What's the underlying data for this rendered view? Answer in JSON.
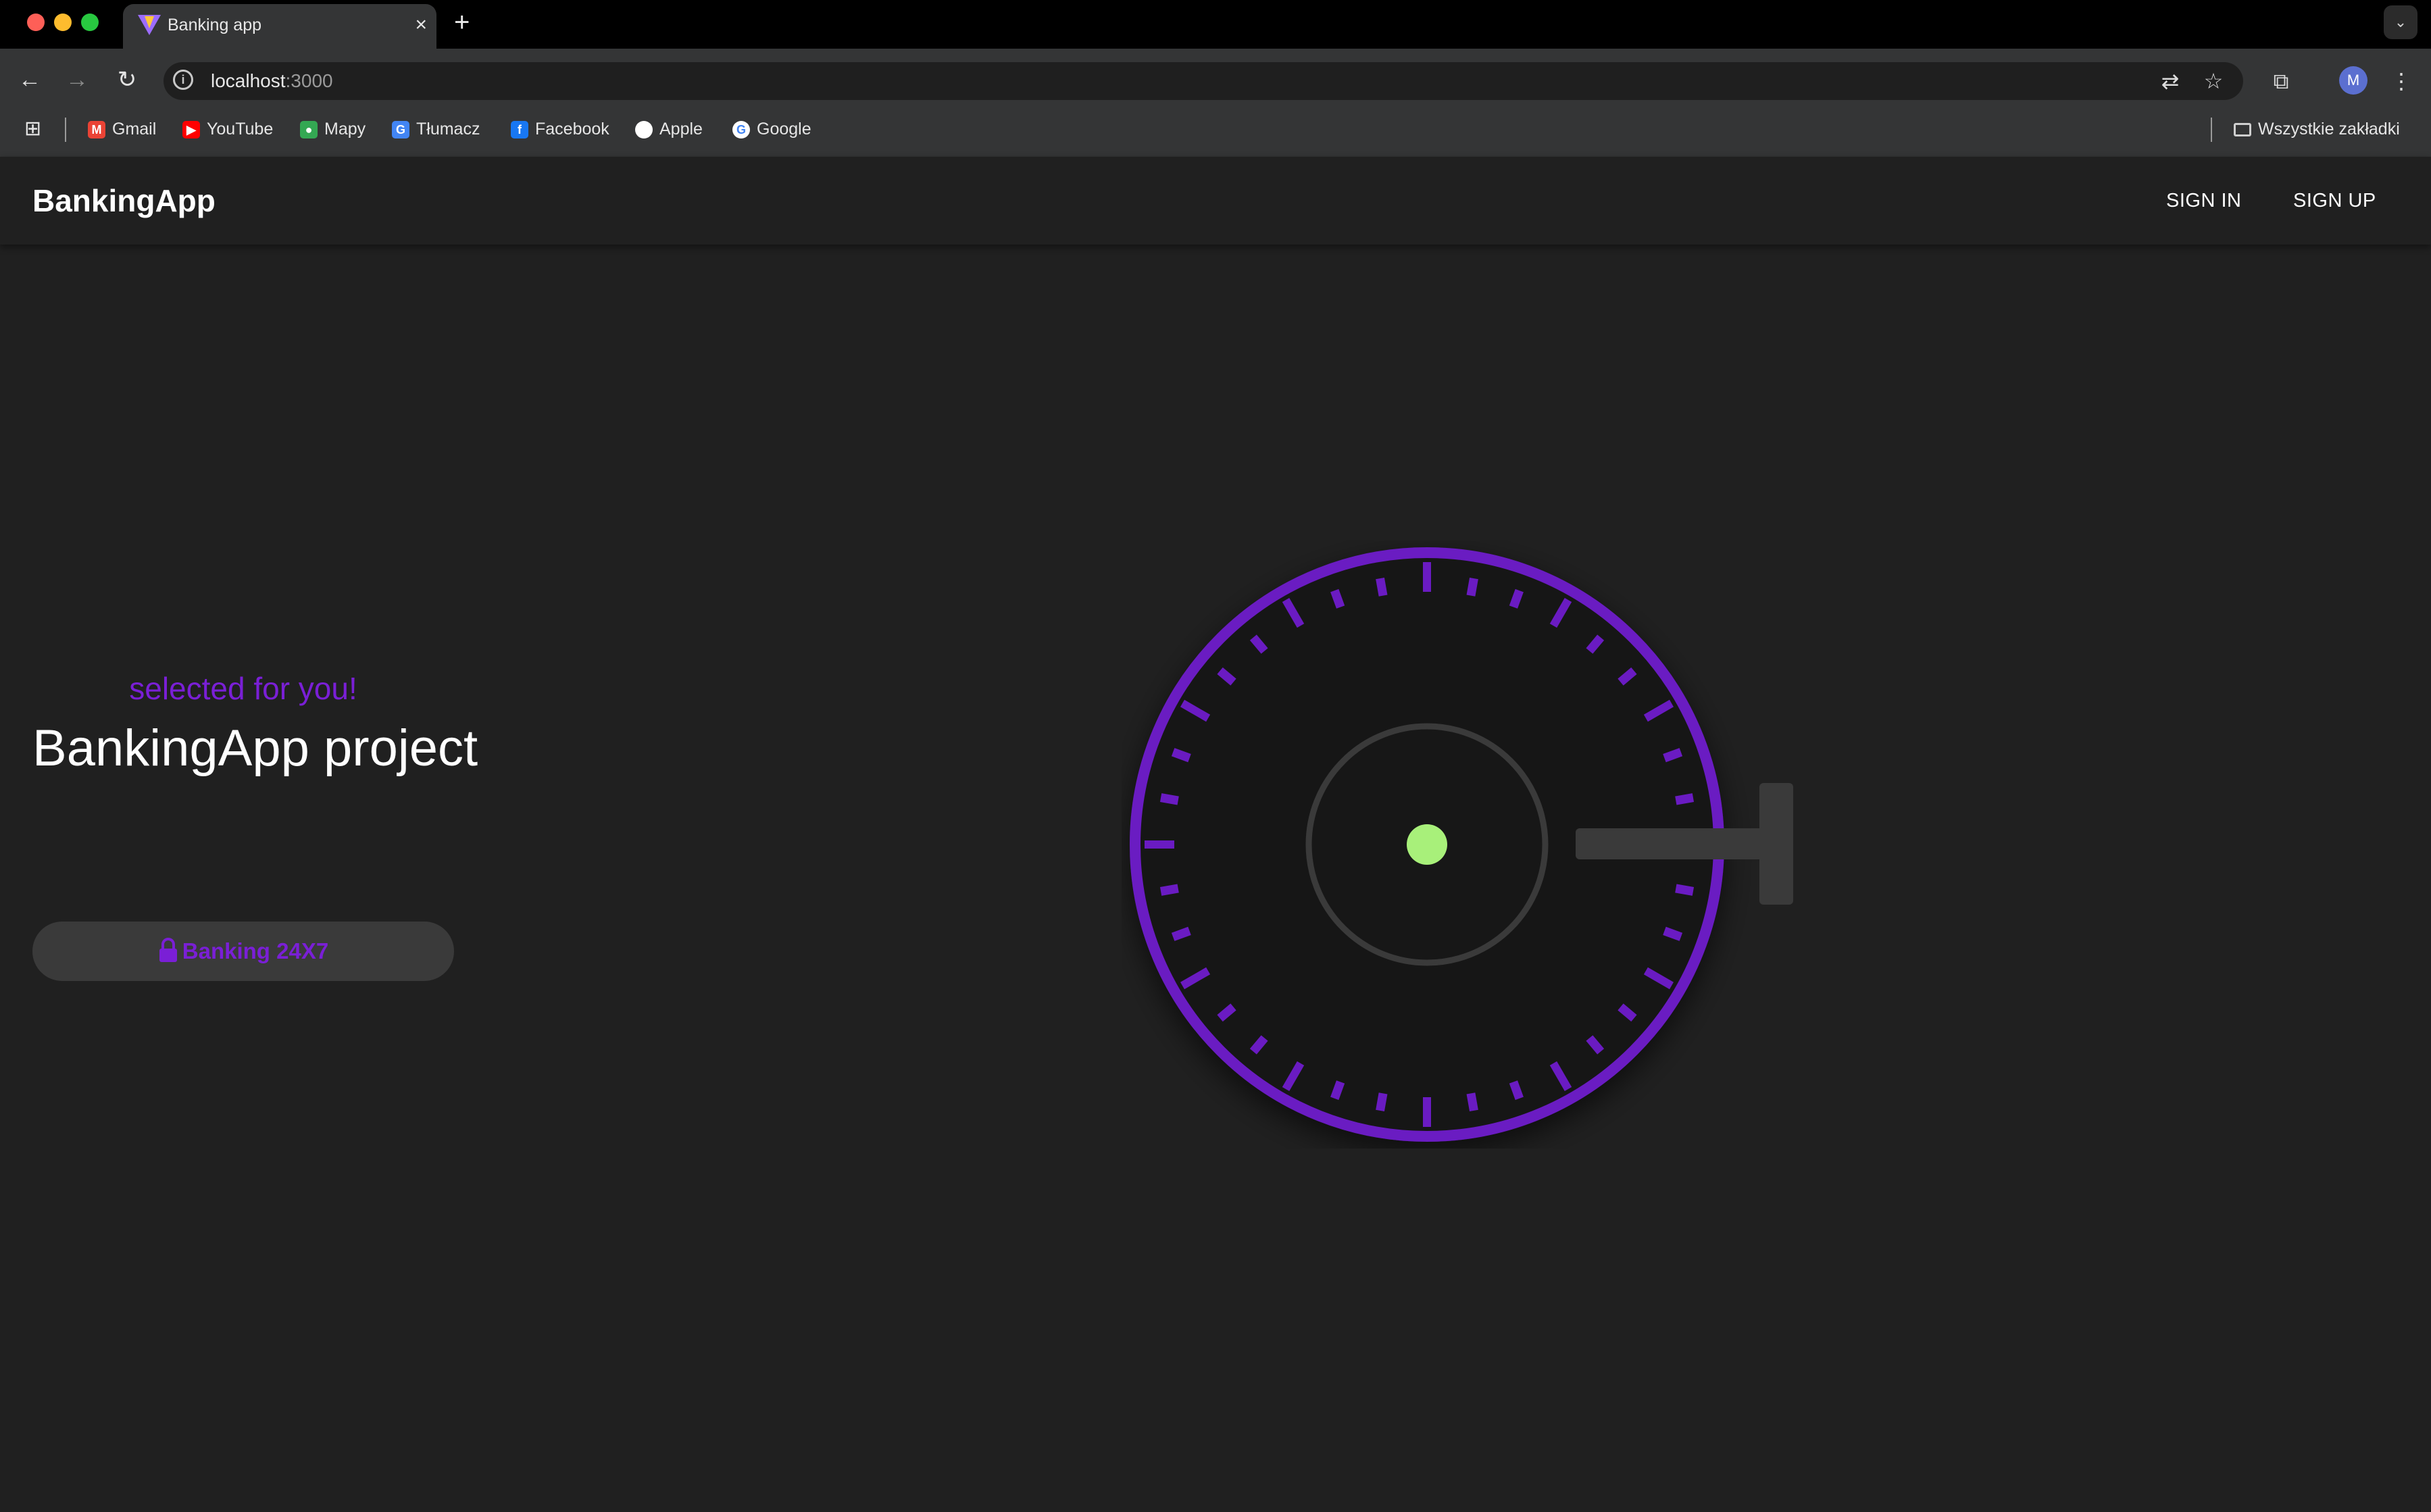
{
  "browser": {
    "tab_title": "Banking app",
    "tab_close": "×",
    "new_tab": "+",
    "tab_search_icon": "chevron-down-icon",
    "url_host": "localhost",
    "url_port": ":3000",
    "avatar_initial": "M",
    "bookmarks": [
      {
        "label": "Gmail",
        "icon": "gmail-icon",
        "color": "#ea4335"
      },
      {
        "label": "YouTube",
        "icon": "youtube-icon",
        "color": "#ff0000"
      },
      {
        "label": "Mapy",
        "icon": "maps-icon",
        "color": "#34a853"
      },
      {
        "label": "Tłumacz",
        "icon": "translate-icon",
        "color": "#4285f4"
      },
      {
        "label": "Facebook",
        "icon": "facebook-icon",
        "color": "#1877f2"
      },
      {
        "label": "Apple",
        "icon": "apple-icon",
        "color": "#ffffff"
      },
      {
        "label": "Google",
        "icon": "google-icon",
        "color": "#ffffff"
      }
    ],
    "all_bookmarks": "Wszystkie zakładki"
  },
  "app": {
    "brand": "BankingApp",
    "nav": {
      "sign_in": "SIGN IN",
      "sign_up": "SIGN UP"
    },
    "hero": {
      "subtitle": "selected for you!",
      "title": "BankingApp project",
      "cta_label": "Banking 24X7"
    }
  },
  "colors": {
    "accent": "#7a1fd6",
    "vault_ring": "#6a1bc2",
    "status_light": "#a8f07a",
    "background": "#202020"
  }
}
